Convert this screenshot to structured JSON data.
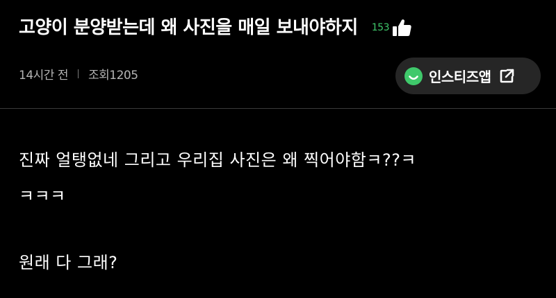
{
  "post": {
    "title": "고양이 분양받는데 왜 사진을 매일 보내야하지",
    "like_count": "153",
    "time_ago": "14시간 전",
    "views": "조회1205"
  },
  "app_button": {
    "label": "인스티즈앱",
    "logo_icon": "instiz-smile-logo-icon",
    "external_icon": "external-link-icon",
    "logo_color": "#3fc96b"
  },
  "body": {
    "lines": [
      "진짜 얼탱없네 그리고 우리집 사진은 왜 찍어야함ㅋ??ㅋ",
      "ㅋㅋㅋ",
      "",
      "원래 다 그래?"
    ]
  },
  "colors": {
    "background": "#000000",
    "text": "#ffffff",
    "meta": "#b4b4b4",
    "accent_green": "#3fc96b",
    "button_bg": "#262626"
  }
}
